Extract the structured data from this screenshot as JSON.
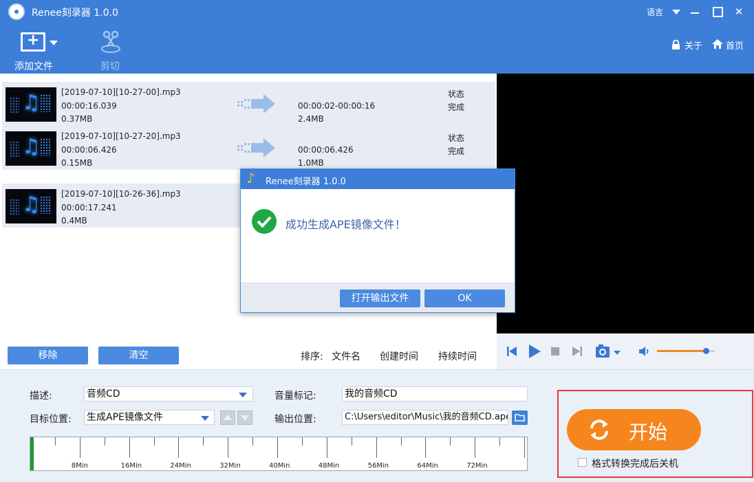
{
  "window": {
    "title": "Renee刻录器 1.0.0",
    "language_label": "语言",
    "close_glyph": "✕"
  },
  "toolbar": {
    "add_file_label": "添加文件",
    "cut_label": "剪切",
    "about_label": "关于",
    "home_label": "首页"
  },
  "files": [
    {
      "name": "[2019-07-10][10-27-00].mp3",
      "duration": "00:00:16.039",
      "size": "0.37MB",
      "output_range": "00:00:02-00:00:16",
      "output_size": "2.4MB",
      "status_label": "状态",
      "status": "完成"
    },
    {
      "name": "[2019-07-10][10-27-20].mp3",
      "duration": "00:00:06.426",
      "size": "0.15MB",
      "output_range": "00:00:06.426",
      "output_size": "1.0MB",
      "status_label": "状态",
      "status": "完成"
    },
    {
      "name": "[2019-07-10][10-26-36].mp3",
      "duration": "00:00:17.241",
      "size": "0.4MB",
      "output_range": "",
      "output_size": "",
      "status_label": "",
      "status": ""
    }
  ],
  "list_actions": {
    "remove_label": "移除",
    "clear_label": "清空",
    "sort_label": "排序:",
    "sort_by_name": "文件名",
    "sort_by_created": "创建时间",
    "sort_by_duration": "持续时间"
  },
  "player": {
    "volume_level": 0.85,
    "accent_color": "#f0891f"
  },
  "settings": {
    "description_label": "描述:",
    "description_value": "音频CD",
    "target_label": "目标位置:",
    "target_value": "生成APE镜像文件",
    "volume_label_label": "音量标记:",
    "volume_label_value": "我的音频CD",
    "output_label": "输出位置:",
    "output_value": "C:\\Users\\editor\\Music\\我的音频CD.ape"
  },
  "timeline": {
    "ticks": [
      "8Min",
      "16Min",
      "24Min",
      "32Min",
      "40Min",
      "48Min",
      "56Min",
      "64Min",
      "72Min"
    ]
  },
  "start": {
    "label": "开始",
    "shutdown_label": "格式转换完成后关机",
    "shutdown_checked": false,
    "button_color": "#f7851e"
  },
  "dialog": {
    "title": "Renee刻录器 1.0.0",
    "message": "成功生成APE镜像文件！",
    "open_output_label": "打开输出文件",
    "ok_label": "OK"
  }
}
